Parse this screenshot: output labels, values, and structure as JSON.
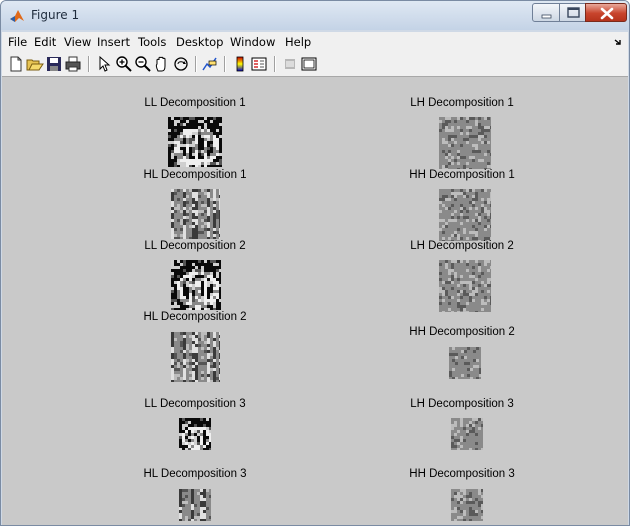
{
  "window": {
    "title": "Figure 1"
  },
  "menu": {
    "items": [
      "File",
      "Edit",
      "View",
      "Insert",
      "Tools",
      "Desktop",
      "Window",
      "Help"
    ]
  },
  "toolbar": {
    "icons": [
      "new-file-icon",
      "open-file-icon",
      "save-icon",
      "print-icon",
      "pointer-icon",
      "zoom-in-icon",
      "zoom-out-icon",
      "pan-icon",
      "rotate-3d-icon",
      "data-cursor-icon",
      "colorbar-icon",
      "legend-icon",
      "hide-plot-tools-icon",
      "show-plot-tools-icon"
    ]
  },
  "subplots": [
    {
      "title": "LL Decomposition 1",
      "kind": "LL"
    },
    {
      "title": "LH Decomposition 1",
      "kind": "noise"
    },
    {
      "title": "HL Decomposition 1",
      "kind": "HL"
    },
    {
      "title": "HH Decomposition 1",
      "kind": "noise"
    },
    {
      "title": "LL Decomposition 2",
      "kind": "LL"
    },
    {
      "title": "LH Decomposition 2",
      "kind": "noise"
    },
    {
      "title": "HL Decomposition 2",
      "kind": "HL"
    },
    {
      "title": "HH Decomposition 2",
      "kind": "noise"
    },
    {
      "title": "LL Decomposition 3",
      "kind": "LL"
    },
    {
      "title": "LH Decomposition 3",
      "kind": "noise"
    },
    {
      "title": "HL Decomposition 3",
      "kind": "HL"
    },
    {
      "title": "HH Decomposition 3",
      "kind": "noise"
    }
  ],
  "colors": {
    "canvas": "#c9c9c9",
    "image_gray": "#8a8a8a"
  }
}
